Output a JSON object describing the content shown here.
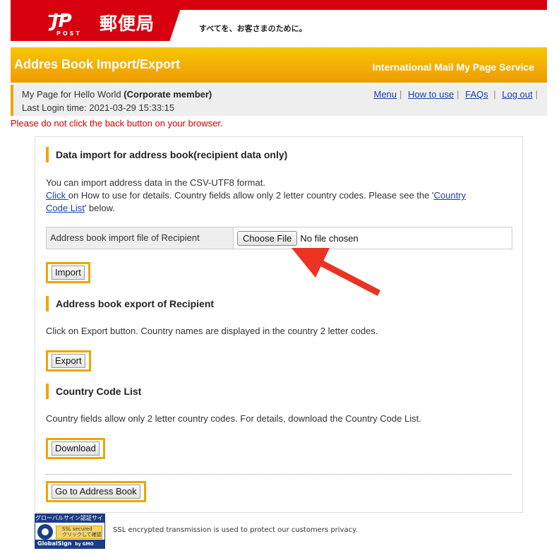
{
  "header": {
    "logo_text": "郵便局",
    "logo_post": "POST",
    "tagline": "すべてを、お客さまのために。"
  },
  "title_bar": {
    "title": "Addres Book Import/Export",
    "service_name": "International Mail My Page Service"
  },
  "user_bar": {
    "page_for": "My Page for Hello World",
    "member_type": "(Corporate member)",
    "last_login_label": "Last Login time:",
    "last_login_value": "2021-03-29 15:33:15",
    "nav": [
      {
        "label": "Menu"
      },
      {
        "label": "How to use"
      },
      {
        "label": "FAQs"
      },
      {
        "label": "Log out"
      }
    ]
  },
  "warning": "Please do not click the back button on your browser.",
  "import_section": {
    "heading": "Data import for address book(recipient data only)",
    "line1": "You can import address data in the CSV-UTF8 format.",
    "click_link": "Click ",
    "line2_mid": "on How to use for details. Country fields allow only 2 letter country codes. Please see the '",
    "country_link_a": "Country",
    "country_link_b": "Code List",
    "line3_end": "' below.",
    "file_label": "Address book import file of Recipient",
    "choose_file": "Choose File",
    "no_file": "No file chosen",
    "button": "Import"
  },
  "export_section": {
    "heading": "Address book export of Recipient",
    "text": "Click on Export button. Country names are displayed in the country 2 letter codes.",
    "button": "Export"
  },
  "country_section": {
    "heading": "Country Code List",
    "text": "Country fields allow only 2 letter country codes. For details, download the Country Code List.",
    "button": "Download"
  },
  "address_book_button": "Go to Address Book",
  "footer": {
    "badge_top": "グローバルサイン認証サイト",
    "badge_secured": "SSL secured",
    "badge_click": "クリックして確認",
    "badge_bottom": "GlobalSign",
    "badge_by": "by GMO",
    "ssl_text": "SSL encrypted transmission is used to protect our customers privacy."
  },
  "colors": {
    "brand_red": "#d7000f",
    "accent_orange": "#f0a500",
    "link_blue": "#1a3fa8",
    "warning_red": "#cc0000",
    "arrow_red": "#ea3323"
  }
}
